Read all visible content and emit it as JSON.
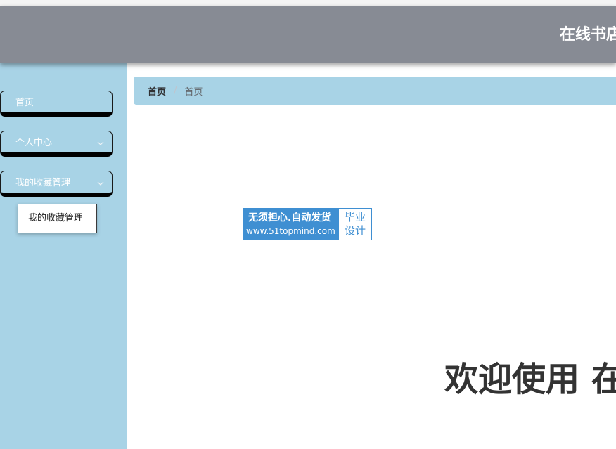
{
  "header": {
    "title": "在线书店"
  },
  "sidebar": {
    "items": [
      {
        "label": "首页"
      },
      {
        "label": "个人中心",
        "icon": "chevron-down-icon"
      },
      {
        "label": "我的收藏管理",
        "icon": "chevron-down-icon"
      }
    ],
    "submenu": {
      "items": [
        {
          "label": "我的收藏管理"
        }
      ]
    }
  },
  "breadcrumb": {
    "items": [
      {
        "label": "首页"
      },
      {
        "label": "首页"
      }
    ],
    "separator": "/"
  },
  "watermark": {
    "line1": "无须担心.自动发货",
    "line2": "www.51topmind.com",
    "badge_line1": "毕业",
    "badge_line2": "设计"
  },
  "main": {
    "welcome_text": "欢迎使用 在"
  },
  "colors": {
    "header_bg": "#878b94",
    "sidebar_bg": "#a8d3e6",
    "breadcrumb_bg": "#a8d3e6",
    "watermark_blue": "#3f8fd2",
    "menu_shadow": "#000000"
  }
}
